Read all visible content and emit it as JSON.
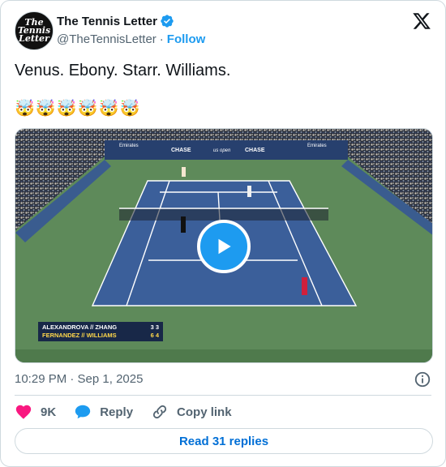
{
  "author": {
    "display_name": "The Tennis Letter",
    "handle": "@TheTennisLetter",
    "follow_label": "Follow",
    "separator": "·",
    "avatar_line1": "The",
    "avatar_line2": "Tennis",
    "avatar_line3": "Letter",
    "verified_color": "#1d9bf0"
  },
  "tweet": {
    "text": "Venus. Ebony. Starr. Williams.",
    "emojis": "🤯🤯🤯🤯🤯🤯"
  },
  "media": {
    "type": "video",
    "play_icon": "play-icon",
    "banner_left": "Emirates",
    "banner_center1": "CHASE",
    "banner_center2": "us open",
    "banner_center3": "CHASE",
    "banner_right": "Emirates",
    "scoreboard": {
      "row1_names": "ALEXANDROVA // ZHANG",
      "row1_scores": "3  3",
      "row2_names": "FERNANDEZ // WILLIAMS",
      "row2_scores": "6  4"
    }
  },
  "meta": {
    "timestamp": "10:29 PM · Sep 1, 2025"
  },
  "actions": {
    "like_count": "9K",
    "reply_label": "Reply",
    "copy_label": "Copy link"
  },
  "read_replies_label": "Read 31 replies",
  "colors": {
    "accent": "#1d9bf0",
    "like": "#f91880",
    "court_blue": "#3b5f9a",
    "court_green": "#5e8a5a"
  }
}
